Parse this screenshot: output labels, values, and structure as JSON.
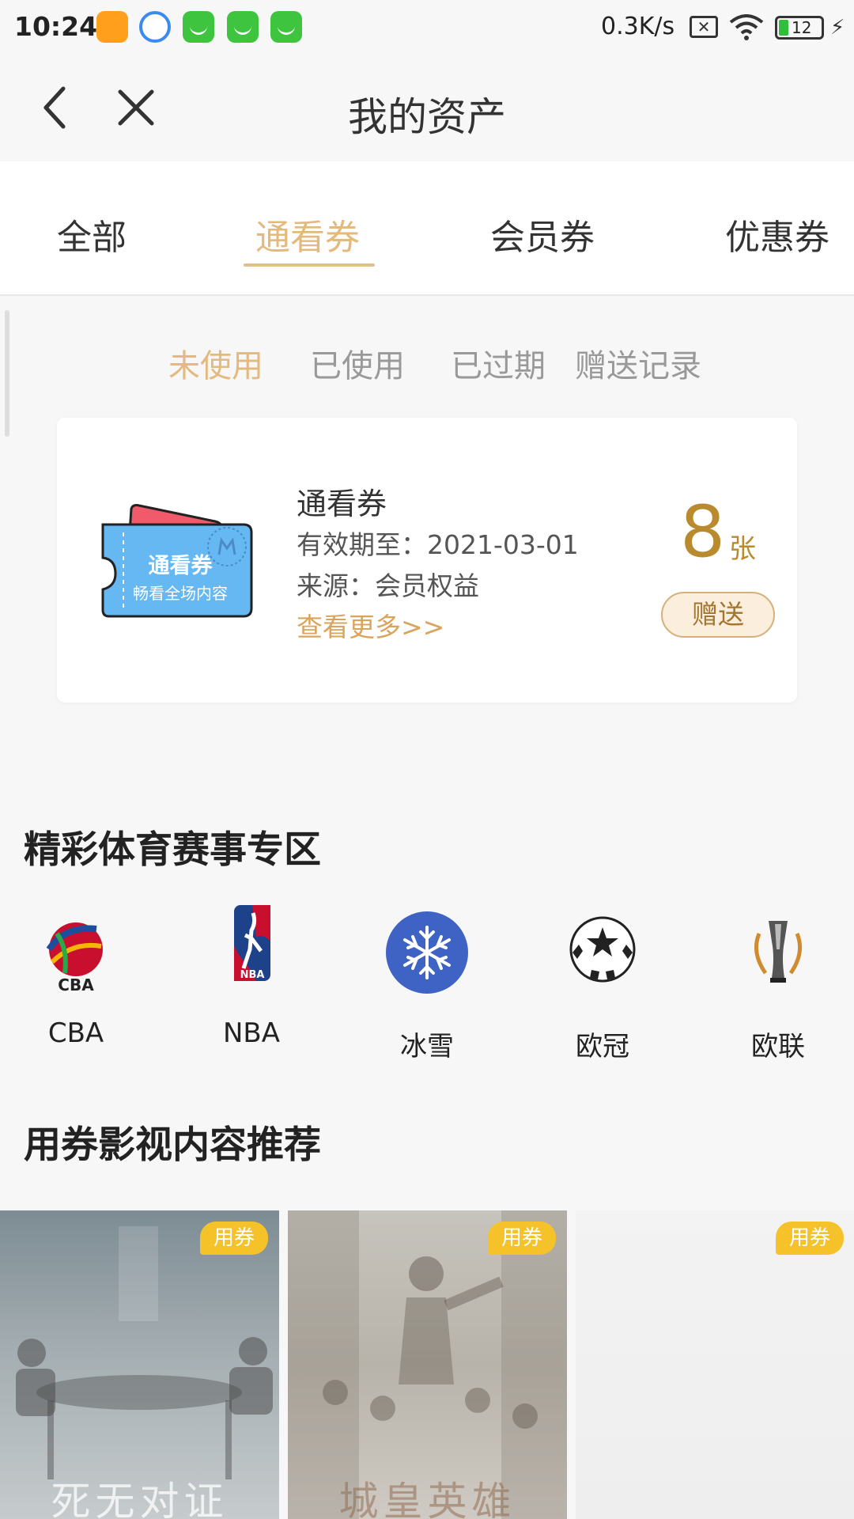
{
  "status_bar": {
    "time": "10:24",
    "network_speed": "0.3K/s",
    "battery": "12",
    "icons": [
      "taobao-icon",
      "browser-icon",
      "wechat-like-icon",
      "wechat-like-icon",
      "wechat-like-icon",
      "sim-x-icon",
      "wifi-icon",
      "battery-icon",
      "charging-icon"
    ]
  },
  "header": {
    "title": "我的资产"
  },
  "tabs": [
    {
      "label": "全部"
    },
    {
      "label": "通看券",
      "active": true
    },
    {
      "label": "会员券"
    },
    {
      "label": "优惠券"
    }
  ],
  "subtabs": [
    {
      "label": "未使用",
      "active": true
    },
    {
      "label": "已使用"
    },
    {
      "label": "已过期"
    },
    {
      "label": "赠送记录"
    }
  ],
  "coupon": {
    "art_title": "通看券",
    "art_subtitle": "畅看全场内容",
    "title": "通看券",
    "valid_until": "有效期至：2021-03-01",
    "source": "来源：会员权益",
    "more": "查看更多>>",
    "count": "8",
    "unit": "张",
    "gift_label": "赠送"
  },
  "sports_section": {
    "title": "精彩体育赛事专区",
    "items": [
      {
        "label": "CBA",
        "icon": "cba-icon"
      },
      {
        "label": "NBA",
        "icon": "nba-icon"
      },
      {
        "label": "冰雪",
        "icon": "snowflake-icon"
      },
      {
        "label": "欧冠",
        "icon": "champions-league-icon"
      },
      {
        "label": "欧联",
        "icon": "europa-league-icon"
      }
    ]
  },
  "recommend_section": {
    "title": "用券影视内容推荐",
    "posters": [
      {
        "badge": "用券",
        "caption": "死无对证"
      },
      {
        "badge": "用券",
        "caption": "城皇英雄"
      },
      {
        "badge": "用券",
        "caption": ""
      }
    ]
  },
  "colors": {
    "accent": "#e3b97e",
    "count": "#b98a2e",
    "badge": "#f6c22a"
  }
}
